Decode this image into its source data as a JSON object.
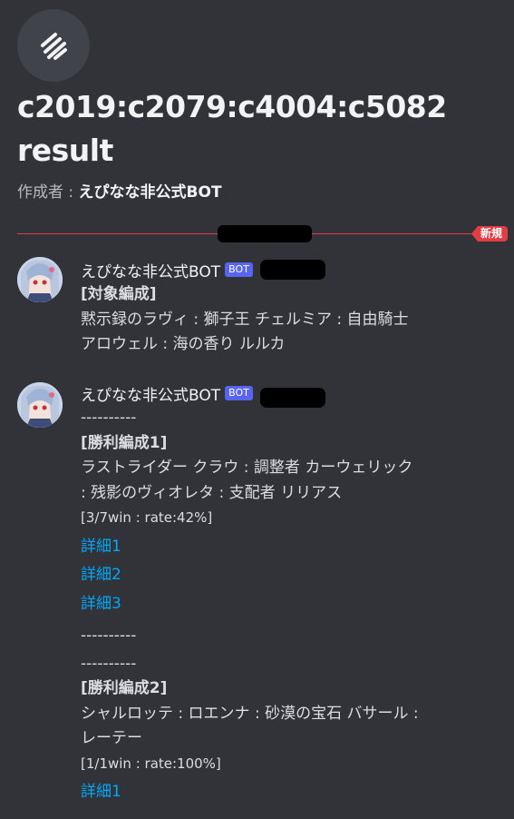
{
  "thread": {
    "icon": "thread-spiral-icon",
    "title_line1": "c2019:c2079:c4004:c5082",
    "title_line2": "result",
    "creator_label": "作成者 : ",
    "creator_name": "えぴなな非公式BOT"
  },
  "divider": {
    "new_badge": "新規"
  },
  "messages": [
    {
      "author": "えぴなな非公式BOT",
      "bot_tag": "BOT",
      "heading": "[対象編成]",
      "lines": [
        "黙示録のラヴィ : 獅子王 チェルミア : 自由騎士",
        "アロウェル : 海の香り ルルカ"
      ]
    },
    {
      "author": "えぴなな非公式BOT",
      "bot_tag": "BOT",
      "sep1": "----------",
      "win1_heading": "[勝利編成1]",
      "win1_lines": [
        "ラストライダー クラウ : 調整者 カーウェリック",
        ": 残影のヴィオレタ : 支配者 リリアス"
      ],
      "win1_rate": "[3/7win : rate:42%]",
      "win1_links": [
        "詳細1",
        "詳細2",
        "詳細3"
      ],
      "sep2": "----------",
      "sep3": "----------",
      "win2_heading": "[勝利編成2]",
      "win2_lines": [
        "シャルロッテ : ロエンナ : 砂漠の宝石 バサール :",
        "レーテー"
      ],
      "win2_rate": "[1/1win : rate:100%]",
      "win2_links": [
        "詳細1"
      ]
    }
  ]
}
